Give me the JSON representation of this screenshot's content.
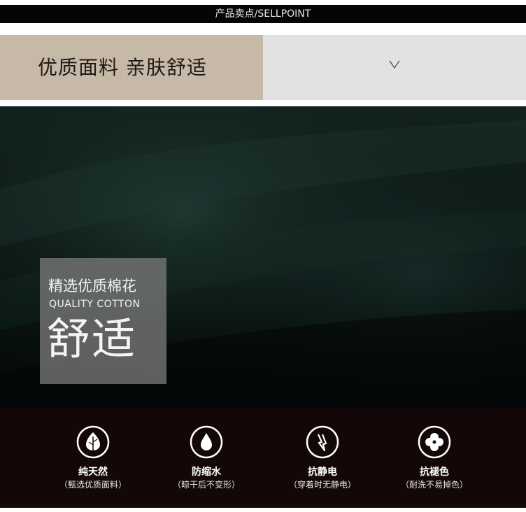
{
  "header": {
    "title": "产品卖点/SELLPOINT"
  },
  "banner": {
    "left_text": "优质面料 亲肤舒适",
    "right_icon": "chevron-down-icon"
  },
  "overlay": {
    "line1": "精选优质棉花",
    "line2": "QUALITY COTTON",
    "line3": "舒适"
  },
  "features": [
    {
      "icon": "leaf-icon",
      "title": "纯天然",
      "sub": "（甄选优质面料）"
    },
    {
      "icon": "water-drop-icon",
      "title": "防缩水",
      "sub": "（晾干后不变形）"
    },
    {
      "icon": "lightning-icon",
      "title": "抗静电",
      "sub": "（穿着时无静电）"
    },
    {
      "icon": "clover-icon",
      "title": "抗褪色",
      "sub": "（耐洗不易掉色）"
    }
  ],
  "colors": {
    "topbar": "#050505",
    "banner_left": "#c7b9a7",
    "banner_right": "#e2e2e2",
    "fabric": "#0a1412",
    "features_bg": "#130707"
  }
}
